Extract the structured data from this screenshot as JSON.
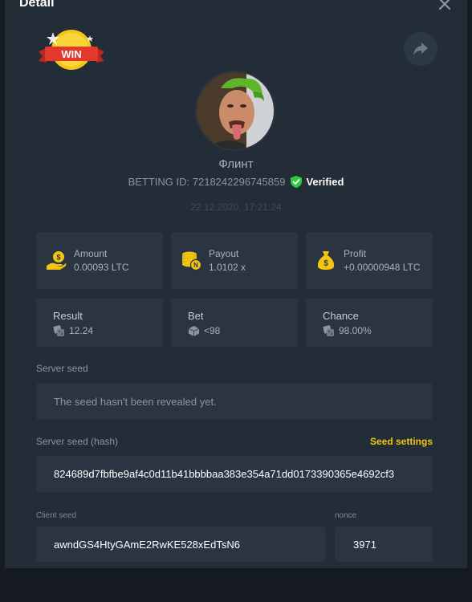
{
  "header": {
    "title": "Detail"
  },
  "badge": {
    "text": "WIN"
  },
  "user": {
    "name": "Флинт",
    "betting_id_label": "BETTING ID: 7218242296745859",
    "verified_label": "Verified",
    "date": "22.12.2020, 17:21:24"
  },
  "stats": [
    {
      "label": "Amount",
      "value": "0.00093 LTC",
      "icon": "hand-coin-icon"
    },
    {
      "label": "Payout",
      "value": "1.0102 x",
      "icon": "coin-stack-icon"
    },
    {
      "label": "Profit",
      "value": "+0.00000948 LTC",
      "icon": "money-bag-icon"
    }
  ],
  "results": [
    {
      "label": "Result",
      "value": "12.24",
      "icon": "dice-icon"
    },
    {
      "label": "Bet",
      "value": "<98",
      "icon": "dice-icon"
    },
    {
      "label": "Chance",
      "value": "98.00%",
      "icon": "dice-icon"
    }
  ],
  "server_seed": {
    "label": "Server seed",
    "value": "The seed hasn't been revealed yet."
  },
  "server_seed_hash": {
    "label": "Server seed (hash)",
    "value": "824689d7fbfbe9af4c0d11b41bbbbaa383e354a71dd0173390365e4692cf3",
    "settings_label": "Seed settings"
  },
  "client_seed": {
    "label": "Client seed",
    "value": "awndGS4HtyGAmE2RwKE528xEdTsN6"
  },
  "nonce": {
    "label": "nonce",
    "value": "3971"
  },
  "colors": {
    "accent_yellow": "#f2c511",
    "verified_green": "#2ecc40",
    "card_bg": "#2a3541",
    "modal_bg": "#232d37"
  }
}
